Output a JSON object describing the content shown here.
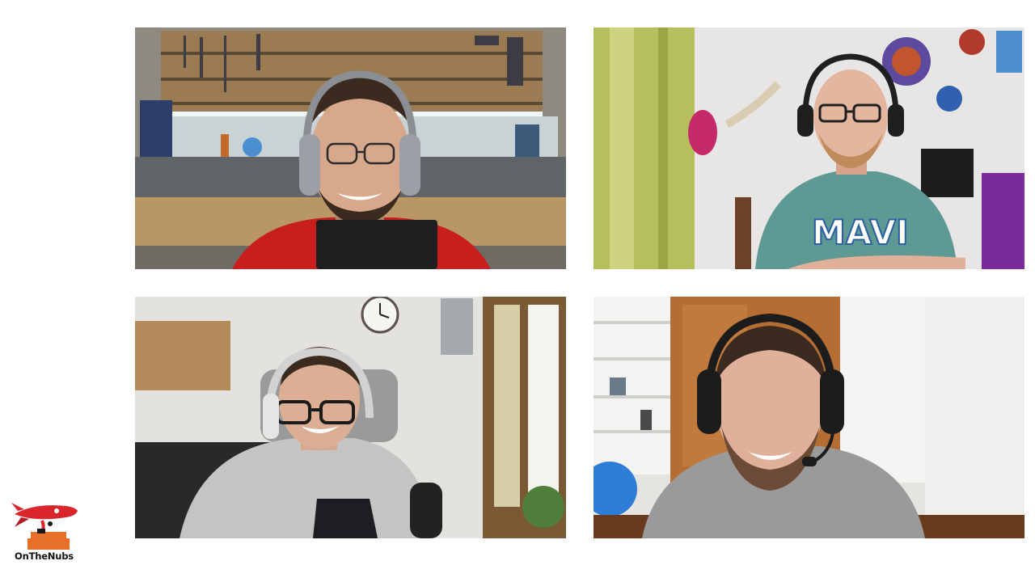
{
  "brand": {
    "logo_text": "OnTheNubs",
    "logo_icon": "rocket-mascot-icon",
    "accent_color": "#d9262c",
    "secondary_color": "#e9702a"
  },
  "participants": [
    {
      "shirt_color": "#c81e1e",
      "headset_icon": "headphones-icon"
    },
    {
      "shirt_color": "#5e9a93",
      "shirt_text": "MAVI",
      "headset_icon": "headset-icon"
    },
    {
      "shirt_color": "#c4c4c4",
      "headset_icon": "earphones-icon"
    },
    {
      "shirt_color": "#9a9a9a",
      "headset_icon": "headset-mic-icon"
    }
  ]
}
